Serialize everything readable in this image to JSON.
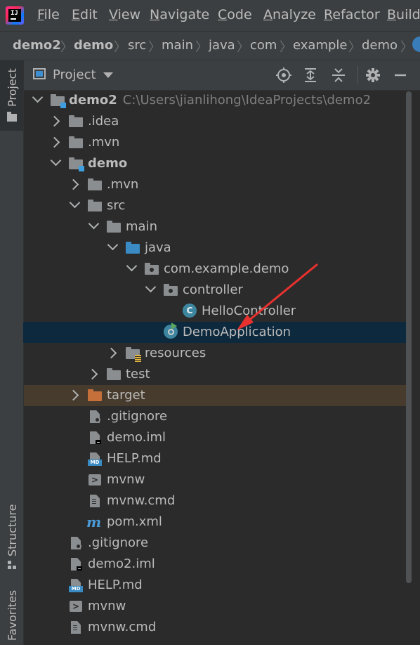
{
  "menu": {
    "items": [
      {
        "label": "File",
        "x": 0
      },
      {
        "label": "Edit"
      },
      {
        "label": "View"
      },
      {
        "label": "Navigate"
      },
      {
        "label": "Code"
      },
      {
        "label": "Analyze"
      },
      {
        "label": "Refactor"
      },
      {
        "label": "Build"
      }
    ]
  },
  "breadcrumb": [
    "demo2",
    "demo",
    "src",
    "main",
    "java",
    "com",
    "example",
    "demo"
  ],
  "tool_strip": {
    "project_tab": "Project",
    "structure_tab": "Structure",
    "favorites_tab": "Favorites"
  },
  "project_panel": {
    "title": "Project",
    "toolbar_icons": [
      "locate-icon",
      "expand-all-icon",
      "collapse-all-icon",
      "settings-icon",
      "minimize-icon"
    ]
  },
  "tree": {
    "root_label": "demo2",
    "root_path": "C:\\Users\\jianlihong\\IdeaProjects\\demo2",
    "rows": [
      {
        "label": ".idea"
      },
      {
        "label": ".mvn"
      },
      {
        "label": "demo"
      },
      {
        "label": ".mvn"
      },
      {
        "label": "src"
      },
      {
        "label": "main"
      },
      {
        "label": "java"
      },
      {
        "label": "com.example.demo"
      },
      {
        "label": "controller"
      },
      {
        "label": "HelloController"
      },
      {
        "label": "DemoApplication"
      },
      {
        "label": "resources"
      },
      {
        "label": "test"
      },
      {
        "label": "target"
      },
      {
        "label": ".gitignore"
      },
      {
        "label": "demo.iml"
      },
      {
        "label": "HELP.md"
      },
      {
        "label": "mvnw"
      },
      {
        "label": "mvnw.cmd"
      },
      {
        "label": "pom.xml"
      },
      {
        "label": ".gitignore"
      },
      {
        "label": "demo2.iml"
      },
      {
        "label": "HELP.md"
      },
      {
        "label": "mvnw"
      },
      {
        "label": "mvnw.cmd"
      }
    ],
    "selected": "DemoApplication"
  },
  "colors": {
    "selection": "#0d293e",
    "excluded": "#463b2c",
    "arrow": "#e8312f",
    "accent": "#3a8ac4"
  },
  "md_badge": "MD",
  "class_badge": "C",
  "maven_badge": "m",
  "term_glyph": ">"
}
